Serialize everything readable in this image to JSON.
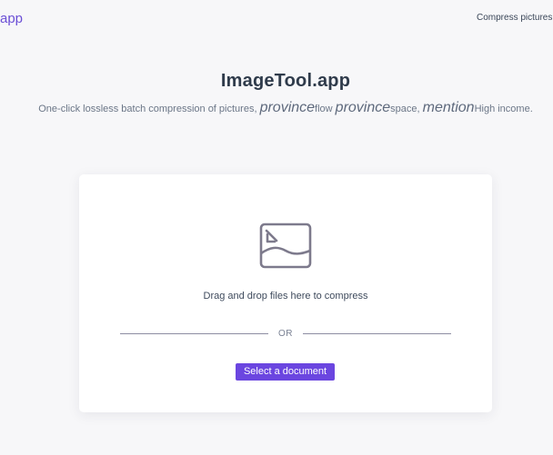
{
  "nav": {
    "logo_text": "app",
    "link_text": "Compress pictures o"
  },
  "hero": {
    "title": "ImageTool.app",
    "subtitle": {
      "part1": "One-click lossless batch compression of pictures,",
      "big1": "province",
      "part2": "flow",
      "big2": "province",
      "part3": "space,",
      "big3": "mention",
      "part4": "High income."
    }
  },
  "upload_card": {
    "icon": "image-upload-icon",
    "drop_text": "Drag and drop files here to compress",
    "or_text": "OR",
    "button_label": "Select a document"
  },
  "colors": {
    "accent": "#6b46e0",
    "logo": "#6b4fd6",
    "background": "#f7f7f9",
    "card": "#ffffff",
    "icon": "#7d7a8c"
  }
}
